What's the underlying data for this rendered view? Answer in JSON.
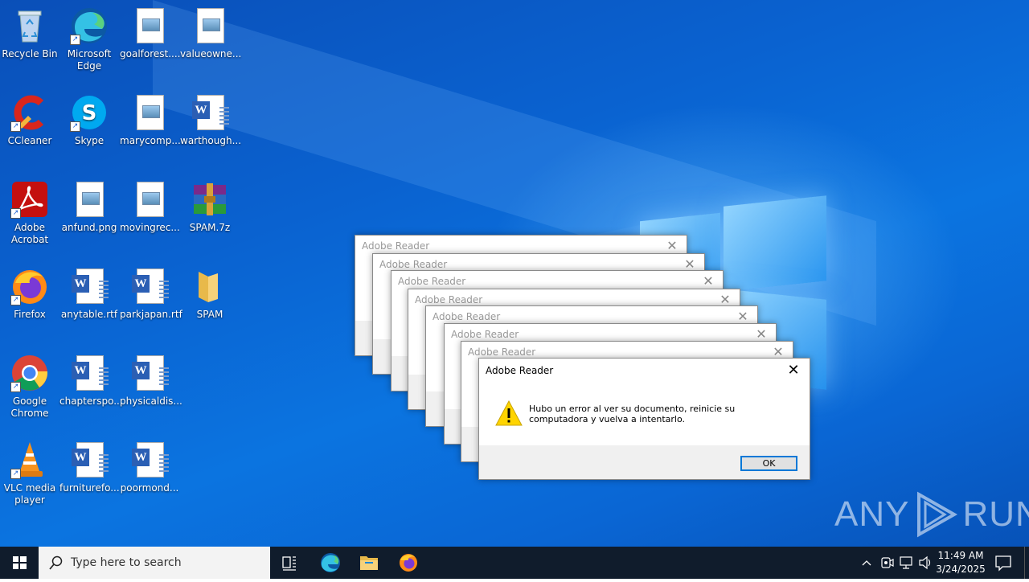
{
  "desktop": {
    "icons": [
      {
        "label": "Recycle Bin"
      },
      {
        "label": "Microsoft Edge"
      },
      {
        "label": "goalforest...."
      },
      {
        "label": "valueowne..."
      },
      {
        "label": "CCleaner"
      },
      {
        "label": "Skype"
      },
      {
        "label": "marycomp..."
      },
      {
        "label": "warthough..."
      },
      {
        "label": "Adobe Acrobat"
      },
      {
        "label": "anfund.png"
      },
      {
        "label": "movingrec..."
      },
      {
        "label": "SPAM.7z"
      },
      {
        "label": "Firefox"
      },
      {
        "label": "anytable.rtf"
      },
      {
        "label": "parkjapan.rtf"
      },
      {
        "label": "SPAM"
      },
      {
        "label": "Google Chrome"
      },
      {
        "label": "chapterspo..."
      },
      {
        "label": "physicaldis..."
      },
      {
        "label": "VLC media player"
      },
      {
        "label": "furniturefo..."
      },
      {
        "label": "poormond..."
      }
    ]
  },
  "dialogs": {
    "stack_title": "Adobe Reader",
    "main": {
      "title": "Adobe Reader",
      "message": "Hubo un error al ver su documento, reinicie su computadora y vuelva a intentarlo.",
      "ok_label": "OK"
    }
  },
  "watermark": {
    "left": "ANY",
    "right": "RUN"
  },
  "taskbar": {
    "search_placeholder": "Type here to search",
    "time": "11:49 AM",
    "date": "3/24/2025"
  },
  "colors": {
    "desktop_blue": "#0a62d0",
    "taskbar": "#101c2c",
    "accent": "#0078d7",
    "warning": "#ffd400"
  }
}
